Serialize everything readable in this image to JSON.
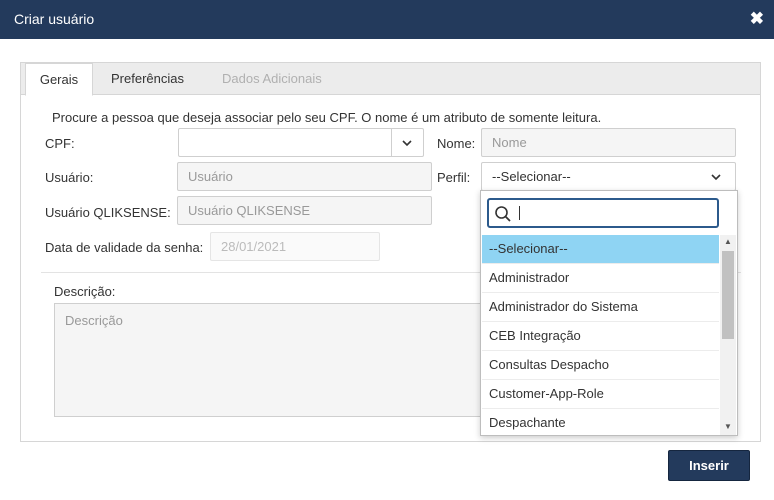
{
  "dialog": {
    "title": "Criar usuário",
    "close_icon": "close-icon"
  },
  "tabs": [
    {
      "label": "Gerais",
      "active": true,
      "enabled": true
    },
    {
      "label": "Preferências",
      "active": false,
      "enabled": true
    },
    {
      "label": "Dados Adicionais",
      "active": false,
      "enabled": false
    }
  ],
  "form": {
    "info_text": "Procure a pessoa que deseja associar pelo seu CPF. O nome é um atributo de somente leitura.",
    "cpf": {
      "label": "CPF:",
      "value": ""
    },
    "nome": {
      "label": "Nome:",
      "placeholder": "Nome"
    },
    "usuario": {
      "label": "Usuário:",
      "placeholder": "Usuário"
    },
    "perfil": {
      "label": "Perfil:",
      "selected": "--Selecionar--"
    },
    "usuario_qlik": {
      "label": "Usuário QLIKSENSE:",
      "placeholder": "Usuário QLIKSENSE"
    },
    "validade": {
      "label": "Data de validade da senha:",
      "placeholder": "28/01/2021"
    },
    "descricao": {
      "label": "Descrição:",
      "placeholder": "Descrição"
    }
  },
  "perfil_dropdown": {
    "search_value": "",
    "options": [
      "--Selecionar--",
      "Administrador",
      "Administrador do Sistema",
      "CEB Integração",
      "Consultas Despacho",
      "Customer-App-Role",
      "Despachante"
    ],
    "highlighted_index": 0
  },
  "footer": {
    "insert_label": "Inserir"
  },
  "colors": {
    "header_bg": "#233a5c",
    "highlight": "#8fd4f3",
    "search_border": "#2c5a8c"
  }
}
